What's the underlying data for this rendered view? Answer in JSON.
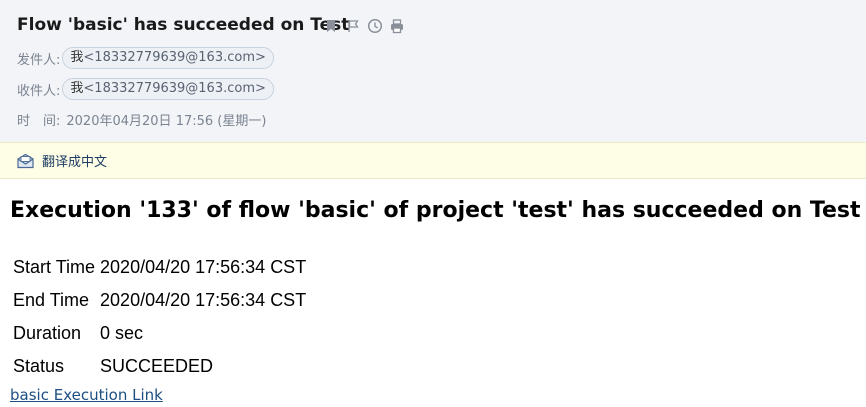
{
  "header": {
    "subject": "Flow 'basic' has succeeded on Test",
    "toolbar_icons": [
      "bookmark-icon",
      "flag-icon",
      "clock-icon",
      "print-icon"
    ],
    "from_label": "发件人:",
    "from_name": "我",
    "from_addr": "<18332779639@163.com>",
    "to_label": "收件人:",
    "to_name": "我",
    "to_addr": "<18332779639@163.com>",
    "time_label": "时　间:",
    "time_value": "2020年04月20日 17:56 (星期一)"
  },
  "translate": {
    "icon": "translate-mail-icon",
    "label": "翻译成中文"
  },
  "content": {
    "headline": "Execution '133' of flow 'basic' of project 'test' has succeeded on Test",
    "rows": [
      {
        "key": "Start Time",
        "value": "2020/04/20 17:56:34 CST"
      },
      {
        "key": "End Time",
        "value": "2020/04/20 17:56:34 CST"
      },
      {
        "key": "Duration",
        "value": "0 sec"
      },
      {
        "key": "Status",
        "value": "SUCCEEDED"
      }
    ],
    "link_text": "basic Execution Link"
  },
  "colors": {
    "header_bg": "#f2f4f8",
    "translate_bg": "#fefde6",
    "link": "#1d4f82",
    "muted": "#7c8491"
  }
}
